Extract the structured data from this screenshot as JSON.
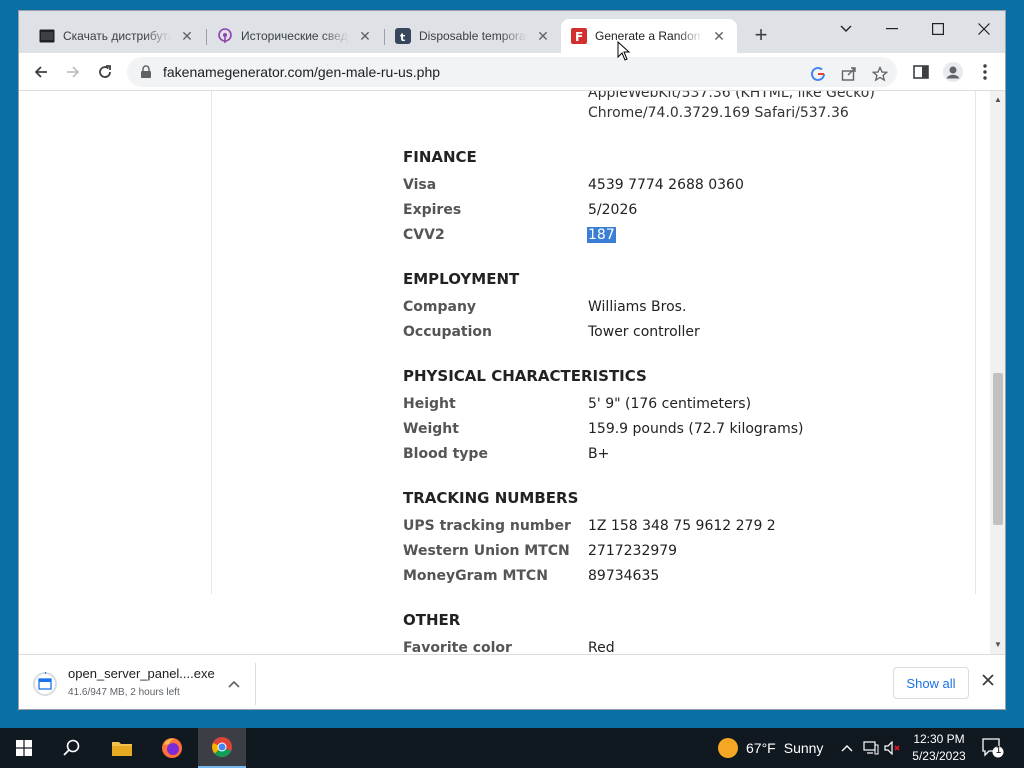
{
  "browser": {
    "tabs": [
      {
        "title": "Скачать дистрибутив",
        "icon": "terminal-icon"
      },
      {
        "title": "Исторические сведения",
        "icon": "podcast-icon"
      },
      {
        "title": "Disposable temporary",
        "icon": "tumblr-icon"
      },
      {
        "title": "Generate a Random Name",
        "icon": "fakenamegenerator-icon",
        "active": true
      }
    ],
    "new_tab": "+",
    "url": "fakenamegenerator.com/gen-male-ru-us.php"
  },
  "page": {
    "useragent_line1": "AppleWebKit/537.36 (KHTML, like Gecko)",
    "useragent_line2": "Chrome/74.0.3729.169 Safari/537.36",
    "finance": {
      "heading": "FINANCE",
      "rows": [
        {
          "label": "Visa",
          "value": "4539 7774 2688 0360"
        },
        {
          "label": "Expires",
          "value": "5/2026"
        },
        {
          "label": "CVV2",
          "value": "187"
        }
      ]
    },
    "employment": {
      "heading": "EMPLOYMENT",
      "rows": [
        {
          "label": "Company",
          "value": "Williams Bros."
        },
        {
          "label": "Occupation",
          "value": "Tower controller"
        }
      ]
    },
    "physical": {
      "heading": "PHYSICAL CHARACTERISTICS",
      "rows": [
        {
          "label": "Height",
          "value": "5' 9\" (176 centimeters)"
        },
        {
          "label": "Weight",
          "value": "159.9 pounds (72.7 kilograms)"
        },
        {
          "label": "Blood type",
          "value": "B+"
        }
      ]
    },
    "tracking": {
      "heading": "TRACKING NUMBERS",
      "rows": [
        {
          "label": "UPS tracking number",
          "value": "1Z 158 348 75 9612 279 2"
        },
        {
          "label": "Western Union MTCN",
          "value": "2717232979"
        },
        {
          "label": "MoneyGram MTCN",
          "value": "89734635"
        }
      ]
    },
    "other": {
      "heading": "OTHER",
      "rows": [
        {
          "label": "Favorite color",
          "value": "Red"
        }
      ]
    }
  },
  "downloads": {
    "file_name": "open_server_panel....exe",
    "progress_text": "41.6/947 MB, 2 hours left",
    "show_all": "Show all"
  },
  "taskbar": {
    "weather_temp": "67°F",
    "weather_text": "Sunny",
    "time": "12:30 PM",
    "date": "5/23/2023",
    "notification_count": "1"
  }
}
